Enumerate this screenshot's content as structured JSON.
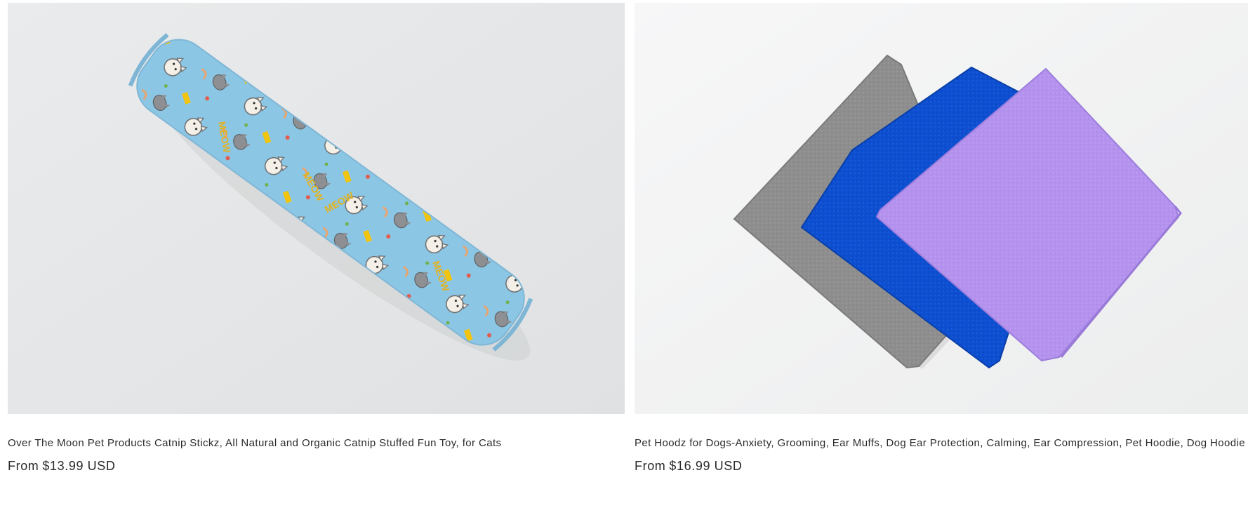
{
  "products": [
    {
      "title": "Over The Moon Pet Products Catnip Stickz, All Natural and Organic Catnip Stuffed Fun Toy, for Cats",
      "price_prefix": "From",
      "price": "$13.99 USD",
      "image_icon": "catnip-stick-image",
      "image_text": "MEOW"
    },
    {
      "title": "Pet Hoodz for Dogs-Anxiety, Grooming, Ear Muffs, Dog Ear Protection, Calming, Ear Compression, Pet Hoodie, Dog Hoodie",
      "price_prefix": "From",
      "price": "$16.99 USD",
      "image_icon": "pet-hoodz-image"
    }
  ],
  "colors": {
    "stick_blue": "#8cc6e5",
    "gray_cloth": "#8e8e8e",
    "blue_cloth": "#0d4fd0",
    "purple_cloth": "#b492ee"
  }
}
